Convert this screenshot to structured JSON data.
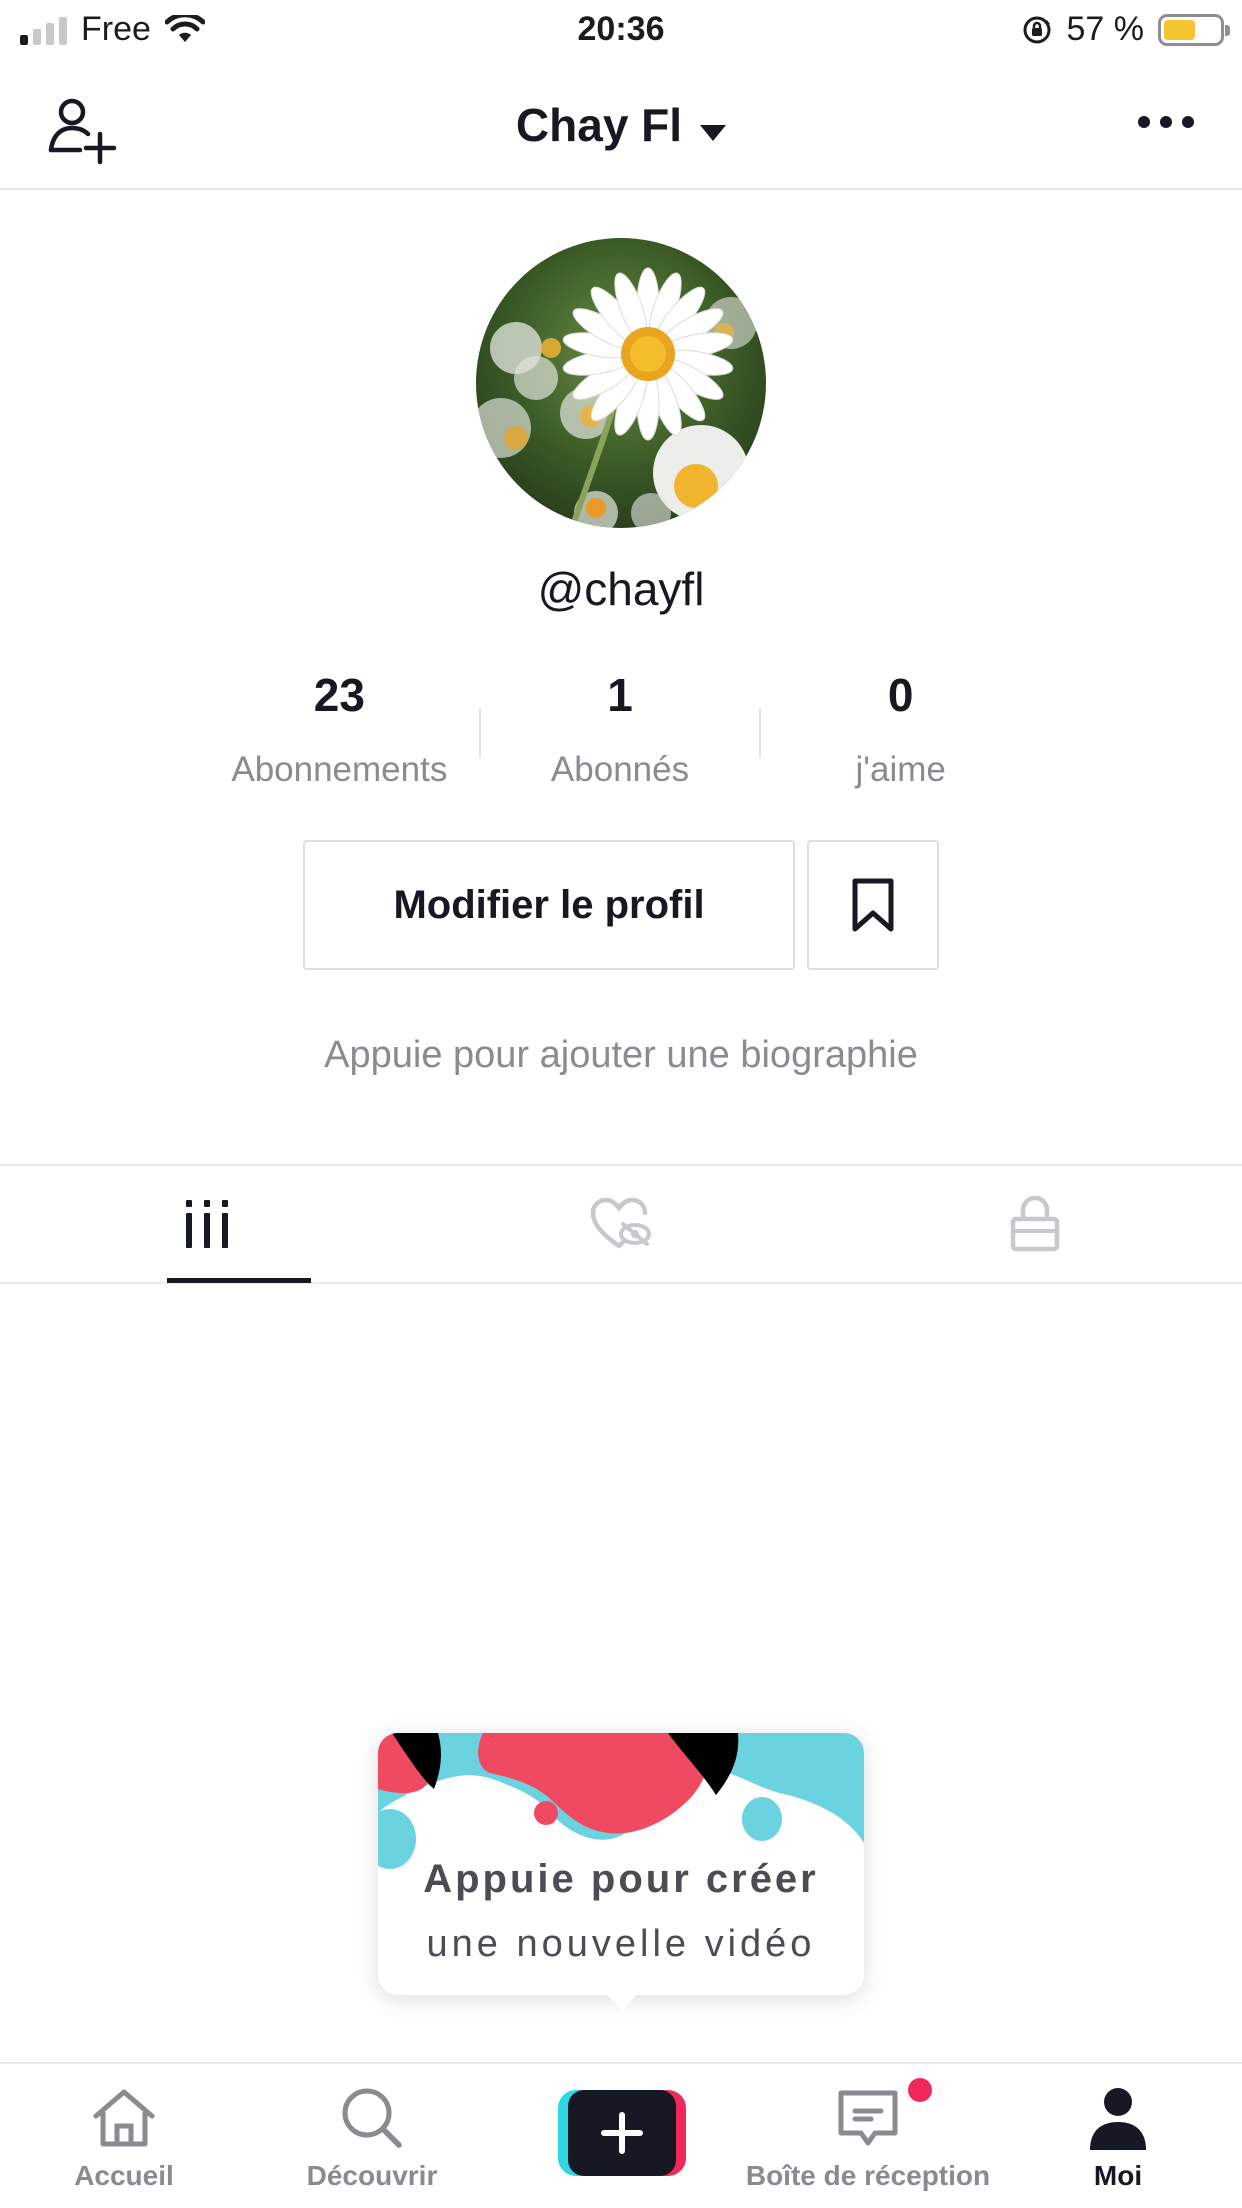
{
  "status_bar": {
    "carrier": "Free",
    "time": "20:36",
    "battery_percent": "57 %",
    "battery_level": 0.57,
    "signal_bars_active": 1,
    "signal_bars_total": 4,
    "icons": [
      "signal-icon",
      "wifi-icon",
      "orientation-lock-icon",
      "battery-icon"
    ]
  },
  "header": {
    "title": "Chay Fl",
    "left_icon": "add-friend-icon",
    "right_icon": "more-icon"
  },
  "profile": {
    "username": "@chayfl",
    "avatar": "daisy-flower-photo",
    "stats": [
      {
        "value": "23",
        "label": "Abonnements"
      },
      {
        "value": "1",
        "label": "Abonnés"
      },
      {
        "value": "0",
        "label": "j'aime"
      }
    ],
    "edit_button_label": "Modifier le profil",
    "bookmark_icon": "bookmark-icon",
    "bio_placeholder": "Appuie pour ajouter une biographie"
  },
  "tabs": [
    {
      "icon": "video-grid-icon",
      "active": true
    },
    {
      "icon": "liked-hidden-icon",
      "active": false
    },
    {
      "icon": "lock-icon",
      "active": false
    }
  ],
  "tooltip": {
    "line1": "Appuie pour créer",
    "line2": "une nouvelle vidéo"
  },
  "bottom_nav": [
    {
      "label": "Accueil",
      "icon": "home-icon",
      "active": false
    },
    {
      "label": "Découvrir",
      "icon": "search-icon",
      "active": false
    },
    {
      "label": "",
      "icon": "plus-icon",
      "active": false
    },
    {
      "label": "Boîte de réception",
      "icon": "inbox-icon",
      "active": false,
      "badge": true
    },
    {
      "label": "Moi",
      "icon": "profile-icon",
      "active": true
    }
  ],
  "colors": {
    "text_primary": "#161823",
    "text_secondary": "#8a8b91",
    "accent_red": "#f1285a",
    "accent_cyan": "#2fd7e0",
    "battery_fill": "#f5c531"
  }
}
